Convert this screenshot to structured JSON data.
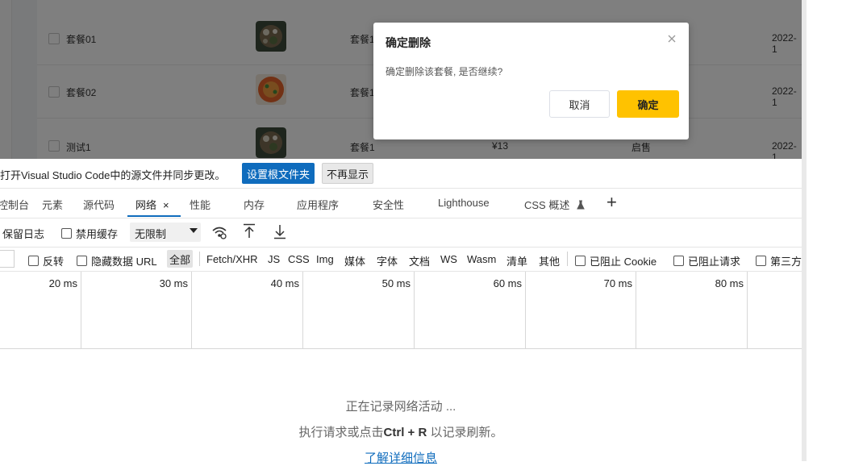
{
  "app": {
    "rows": [
      {
        "name": "套餐01",
        "category": "套餐1",
        "price": "",
        "status": "",
        "date": "2022-1"
      },
      {
        "name": "套餐02",
        "category": "套餐1",
        "price": "",
        "status": "",
        "date": "2022-1"
      },
      {
        "name": "测试1",
        "category": "套餐1",
        "price": "¥13",
        "status": "启售",
        "date": "2022-1"
      }
    ]
  },
  "dialog": {
    "title": "确定删除",
    "message": "确定删除该套餐, 是否继续?",
    "cancel_label": "取消",
    "confirm_label": "确定",
    "confirm_color": "#ffc200"
  },
  "devtools": {
    "infobar": {
      "text": "打开Visual Studio Code中的源文件并同步更改。",
      "set_root_label": "设置根文件夹",
      "dismiss_label": "不再显示"
    },
    "tabs": [
      {
        "label": "控制台"
      },
      {
        "label": "元素"
      },
      {
        "label": "源代码"
      },
      {
        "label": "网络",
        "active": true,
        "close": "×"
      },
      {
        "label": "性能"
      },
      {
        "label": "内存"
      },
      {
        "label": "应用程序"
      },
      {
        "label": "安全性"
      },
      {
        "label": "Lighthouse"
      },
      {
        "label": "CSS 概述"
      },
      {
        "label": "+"
      }
    ],
    "toolbar": {
      "preserve_log": "保留日志",
      "disable_cache": "禁用缓存",
      "throttle_value": "无限制"
    },
    "filter": {
      "invert": "反转",
      "hide_data_urls": "隐藏数据 URL",
      "types": [
        "全部",
        "Fetch/XHR",
        "JS",
        "CSS",
        "Img",
        "媒体",
        "字体",
        "文档",
        "WS",
        "Wasm",
        "清单",
        "其他"
      ],
      "blocked_cookies": "已阻止 Cookie",
      "blocked_requests": "已阻止请求",
      "third_party": "第三方"
    },
    "timeline_ticks": [
      "20 ms",
      "30 ms",
      "40 ms",
      "50 ms",
      "60 ms",
      "70 ms",
      "80 ms"
    ],
    "empty": {
      "line1": "正在记录网络活动 ...",
      "line2_pre": "执行请求或点击",
      "line2_key": "Ctrl + R",
      "line2_post": "以记录刷新。",
      "learn_more": "了解详细信息"
    },
    "accent_color": "#0f6cbd"
  }
}
